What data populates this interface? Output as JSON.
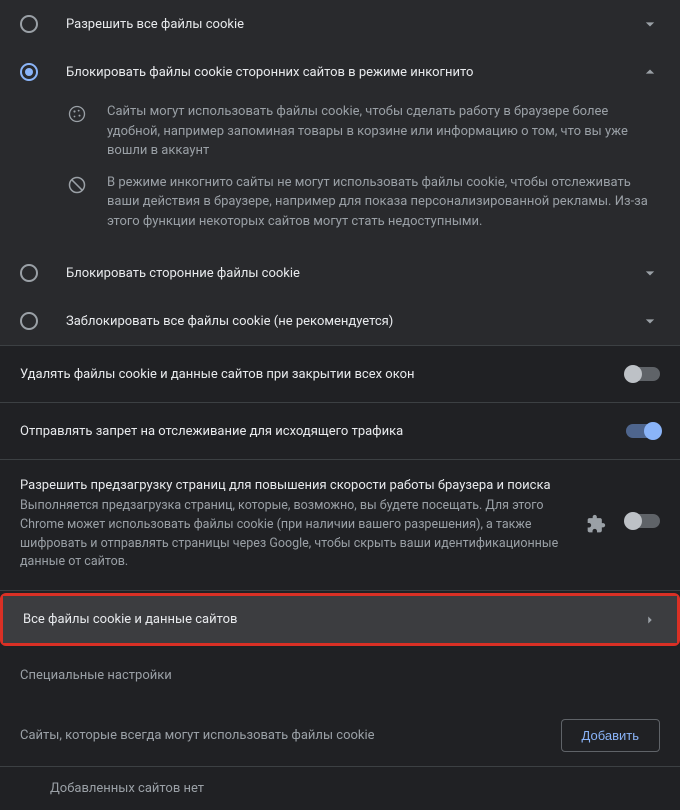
{
  "options": {
    "allow_all": "Разрешить все файлы cookie",
    "block_third_incognito": "Блокировать файлы cookie сторонних сайтов в режиме инкогнито",
    "block_third": "Блокировать сторонние файлы cookie",
    "block_all": "Заблокировать все файлы cookie (не рекомендуется)"
  },
  "desc": {
    "cookie_help": "Сайты могут использовать файлы cookie, чтобы сделать работу в браузере более удобной, например запоминая товары в корзине или информацию о том, что вы уже вошли в аккаунт",
    "incognito_block": "В режиме инкогнито сайты не могут использовать файлы cookie, чтобы отслеживать ваши действия в браузере, например для показа персонализированной рекламы. Из-за этого функции некоторых сайтов могут стать недоступными."
  },
  "toggles": {
    "clear_on_close": "Удалять файлы cookie и данные сайтов при закрытии всех окон",
    "do_not_track": "Отправлять запрет на отслеживание для исходящего трафика",
    "preload_title": "Разрешить предзагрузку страниц для повышения скорости работы браузера и поиска",
    "preload_desc": "Выполняется предзагрузка страниц, которые, возможно, вы будете посещать. Для этого Chrome может использовать файлы cookie (при наличии вашего разрешения), а также шифровать и отправлять страницы через Google, чтобы скрыть ваши идентификационные данные от сайтов."
  },
  "nav": {
    "all_cookies": "Все файлы cookie и данные сайтов"
  },
  "custom": {
    "header": "Специальные настройки",
    "always_allow": "Сайты, которые всегда могут использовать файлы cookie",
    "add_btn": "Добавить",
    "empty": "Добавленных сайтов нет"
  }
}
